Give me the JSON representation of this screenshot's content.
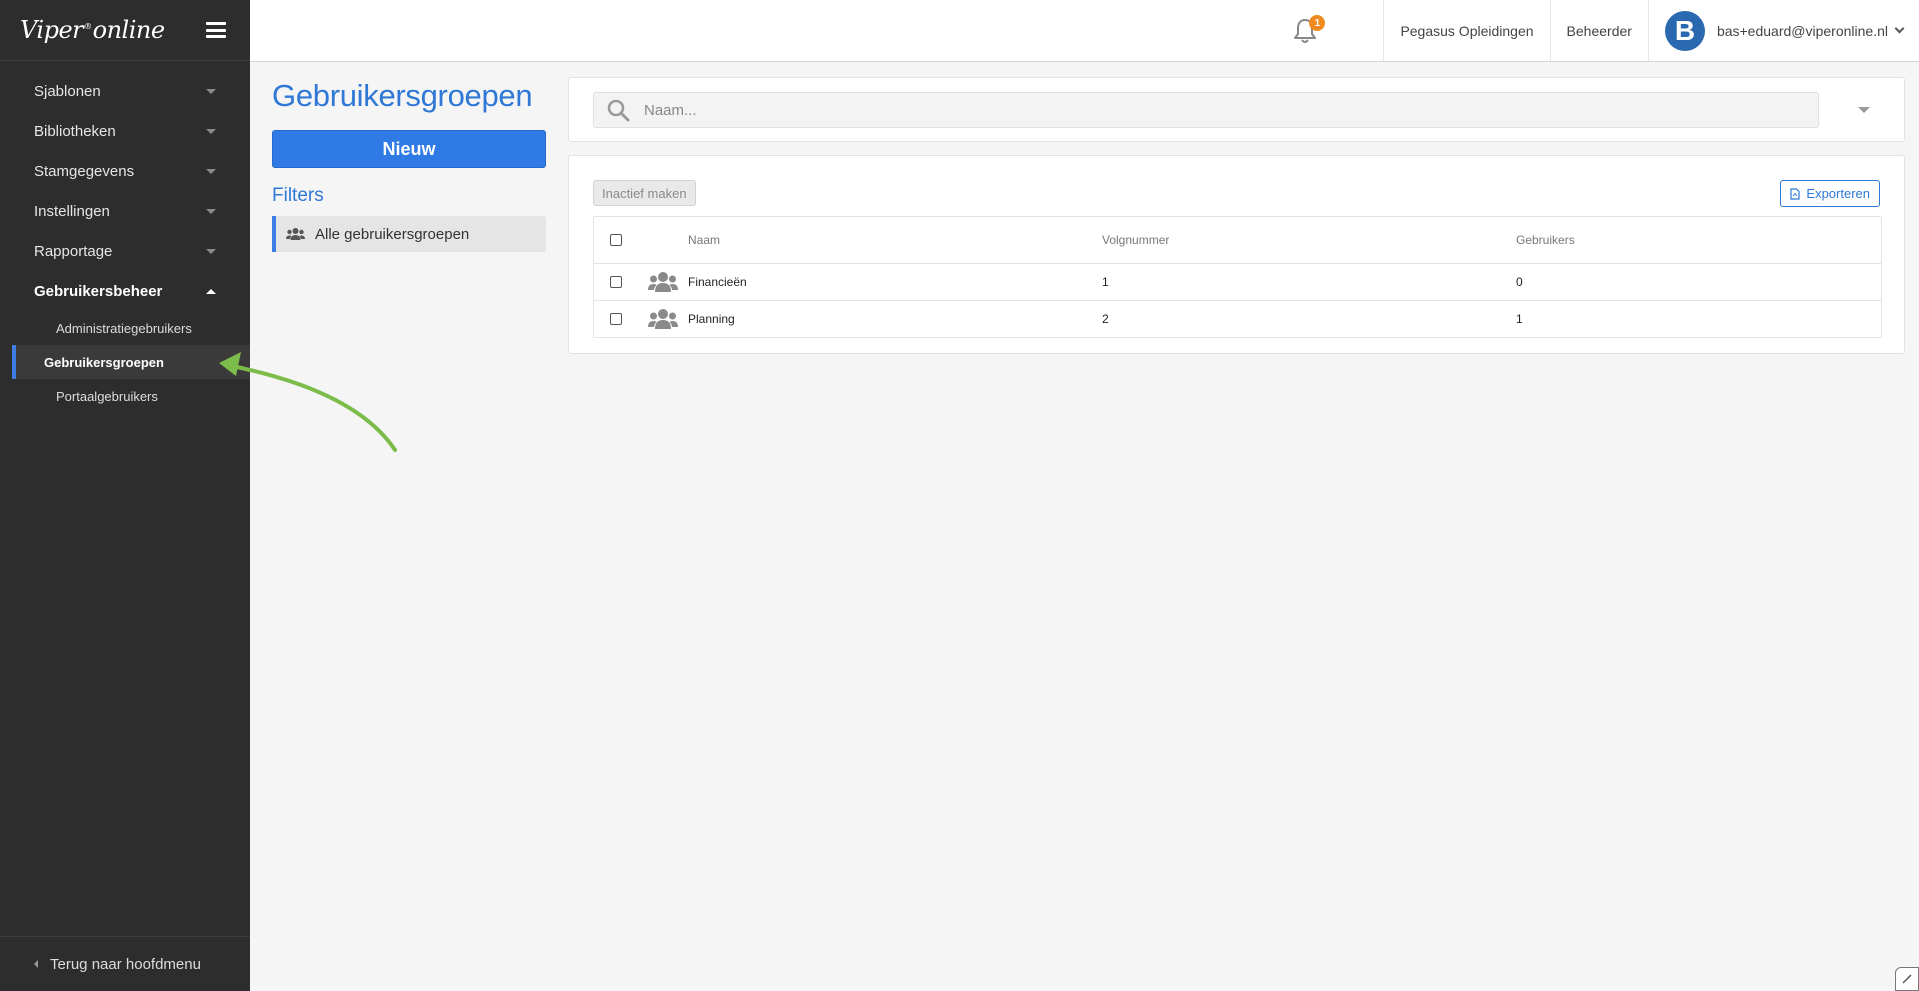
{
  "brand": {
    "name_a": "Viper",
    "name_sup": "®",
    "name_b": "online"
  },
  "sidebar": {
    "items": [
      {
        "label": "Sjablonen"
      },
      {
        "label": "Bibliotheken"
      },
      {
        "label": "Stamgegevens"
      },
      {
        "label": "Instellingen"
      },
      {
        "label": "Rapportage"
      },
      {
        "label": "Gebruikersbeheer"
      }
    ],
    "sub_items": [
      {
        "label": "Administratiegebruikers"
      },
      {
        "label": "Gebruikersgroepen"
      },
      {
        "label": "Portaalgebruikers"
      }
    ],
    "footer_label": "Terug naar hoofdmenu"
  },
  "topbar": {
    "notification_count": "1",
    "organisation": "Pegasus Opleidingen",
    "role": "Beheerder",
    "avatar_initial": "B",
    "user_email": "bas+eduard@viperonline.nl"
  },
  "page": {
    "title": "Gebruikersgroepen",
    "new_button": "Nieuw",
    "filters_title": "Filters",
    "filter_all": "Alle gebruikersgroepen"
  },
  "search": {
    "placeholder": "Naam..."
  },
  "table": {
    "deactivate_button": "Inactief maken",
    "export_button": "Exporteren",
    "columns": {
      "name": "Naam",
      "sequence": "Volgnummer",
      "users": "Gebruikers"
    },
    "rows": [
      {
        "name": "Financieën",
        "sequence": "1",
        "users": "0"
      },
      {
        "name": "Planning",
        "sequence": "2",
        "users": "1"
      }
    ]
  },
  "colors": {
    "sidebar_bg": "#2d2d2d",
    "accent_blue": "#2f78d6",
    "primary_button": "#2f7ae5",
    "badge_orange": "#f08c1f",
    "annotation_arrow": "#7cbc4a"
  }
}
